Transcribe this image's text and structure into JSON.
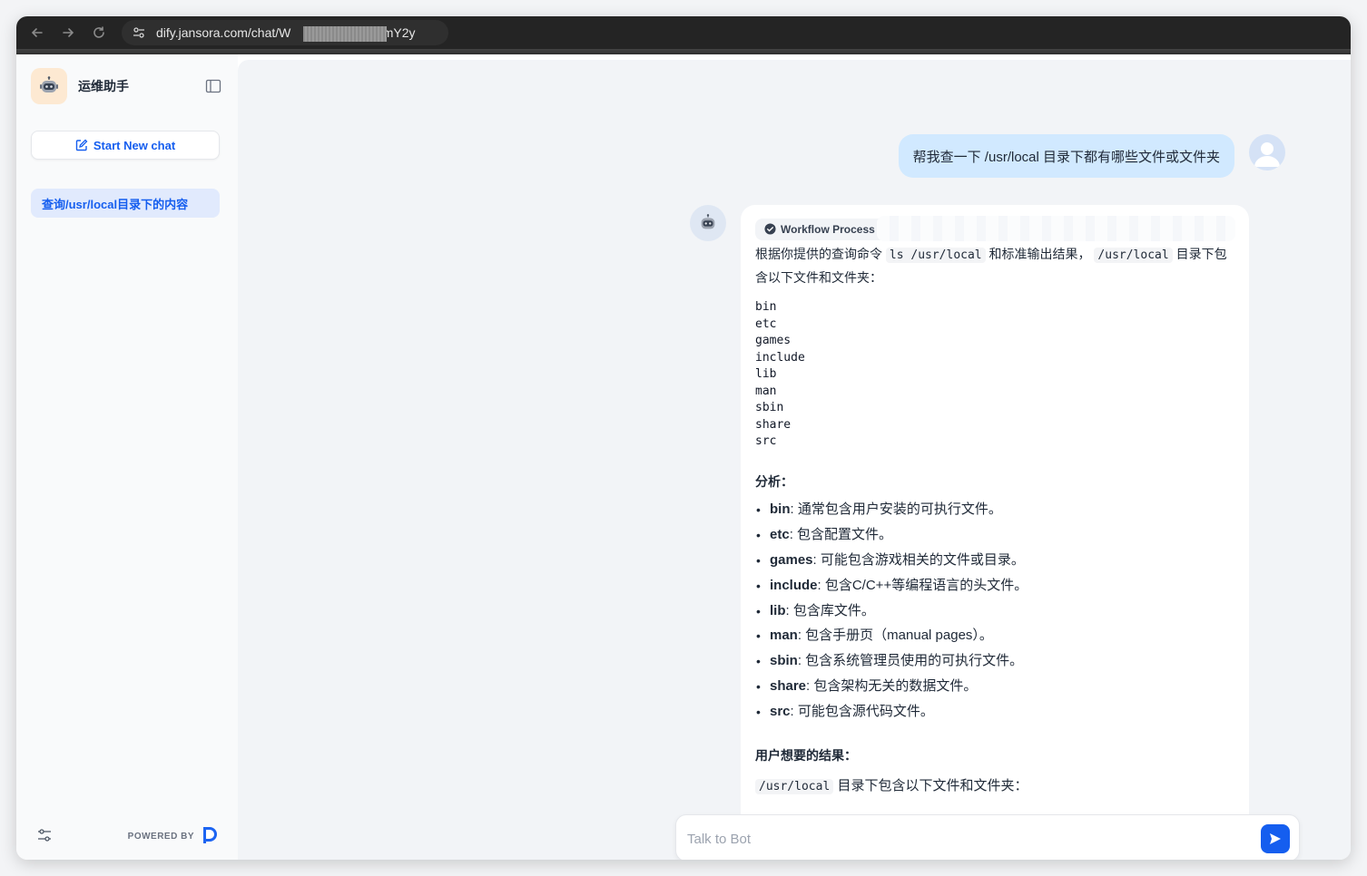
{
  "browser": {
    "url_prefix": "dify.jansora.com/chat/W",
    "url_suffix": "VmY2y"
  },
  "sidebar": {
    "app_name": "运维助手",
    "new_chat_label": "Start New chat",
    "conversations": [
      {
        "title": "查询/usr/local目录下的内容",
        "active": true
      }
    ],
    "powered_by": "POWERED BY"
  },
  "chat": {
    "user_message": "帮我查一下 /usr/local 目录下都有哪些文件或文件夹",
    "workflow_label": "Workflow Process",
    "intro_before_cmd": "根据你提供的查询命令",
    "intro_cmd": "ls /usr/local",
    "intro_middle": "和标准输出结果，",
    "intro_path": "/usr/local",
    "intro_after": "目录下包含以下文件和文件夹：",
    "files": "bin\netc\ngames\ninclude\nlib\nman\nsbin\nshare\nsrc",
    "analysis_title": "分析：",
    "analysis": [
      {
        "name": "bin",
        "desc": ": 通常包含用户安装的可执行文件。"
      },
      {
        "name": "etc",
        "desc": ": 包含配置文件。"
      },
      {
        "name": "games",
        "desc": ": 可能包含游戏相关的文件或目录。"
      },
      {
        "name": "include",
        "desc": ": 包含C/C++等编程语言的头文件。"
      },
      {
        "name": "lib",
        "desc": ": 包含库文件。"
      },
      {
        "name": "man",
        "desc": ": 包含手册页（manual pages）。"
      },
      {
        "name": "sbin",
        "desc": ": 包含系统管理员使用的可执行文件。"
      },
      {
        "name": "share",
        "desc": ": 包含架构无关的数据文件。"
      },
      {
        "name": "src",
        "desc": ": 可能包含源代码文件。"
      }
    ],
    "result_title": "用户想要的结果：",
    "result_path": "/usr/local",
    "result_text": "目录下包含以下文件和文件夹："
  },
  "input": {
    "placeholder": "Talk to Bot",
    "value": ""
  },
  "colors": {
    "accent": "#155eef",
    "user_bubble": "#d1e9ff",
    "active_conversation": "#e1eafd",
    "main_bg": "#f2f4f7"
  }
}
